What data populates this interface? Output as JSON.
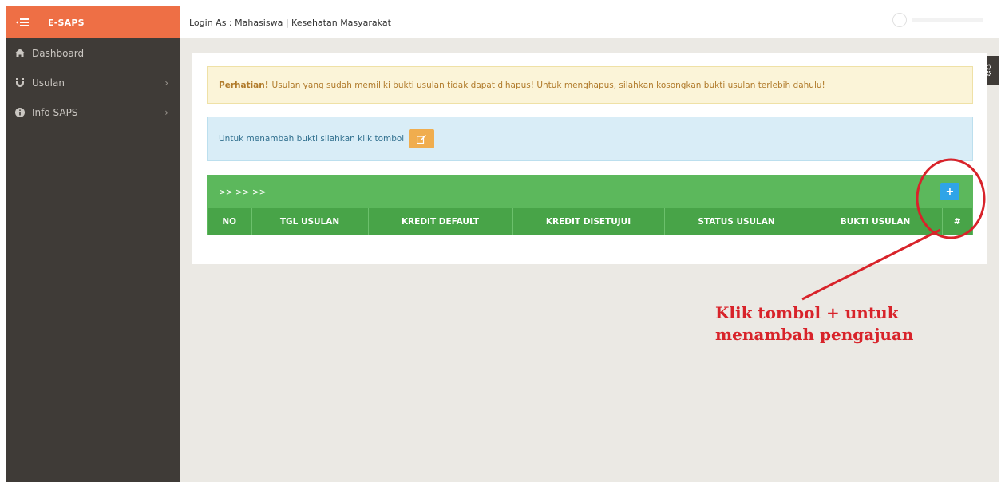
{
  "sidebar": {
    "toggle_icon": "collapse-menu-icon",
    "brand": "E-SAPS",
    "items": [
      {
        "label": "Dashboard",
        "icon": "home-icon",
        "has_submenu": false
      },
      {
        "label": "Usulan",
        "icon": "magnet-icon",
        "has_submenu": true
      },
      {
        "label": "Info SAPS",
        "icon": "info-icon",
        "has_submenu": true
      }
    ],
    "chevron": "›"
  },
  "topbar": {
    "login_text": "Login As : Mahasiswa | Kesehatan Masyarakat"
  },
  "alerts": {
    "warning_bold": "Perhatian!",
    "warning_text": "Usulan yang sudah memiliki bukti usulan tidak dapat dihapus! Untuk menghapus, silahkan kosongkan bukti usulan terlebih dahulu!",
    "info_text": "Untuk menambah bukti silahkan klik tombol"
  },
  "table_box": {
    "header_title": ">> >> >>",
    "add_button": "+",
    "columns": [
      "NO",
      "TGL USULAN",
      "KREDIT DEFAULT",
      "KREDIT DISETUJUI",
      "STATUS USULAN",
      "BUKTI USULAN",
      "#"
    ]
  },
  "annotation": {
    "line1": "Klik tombol + untuk",
    "line2": "menambah pengajuan"
  },
  "colors": {
    "brand": "#ee6f45",
    "sidebar": "#3f3b37",
    "success": "#5cb85c",
    "primary_btn": "#2fa4e7",
    "warning_btn": "#f0ad4e",
    "annotation": "#d8232a"
  }
}
